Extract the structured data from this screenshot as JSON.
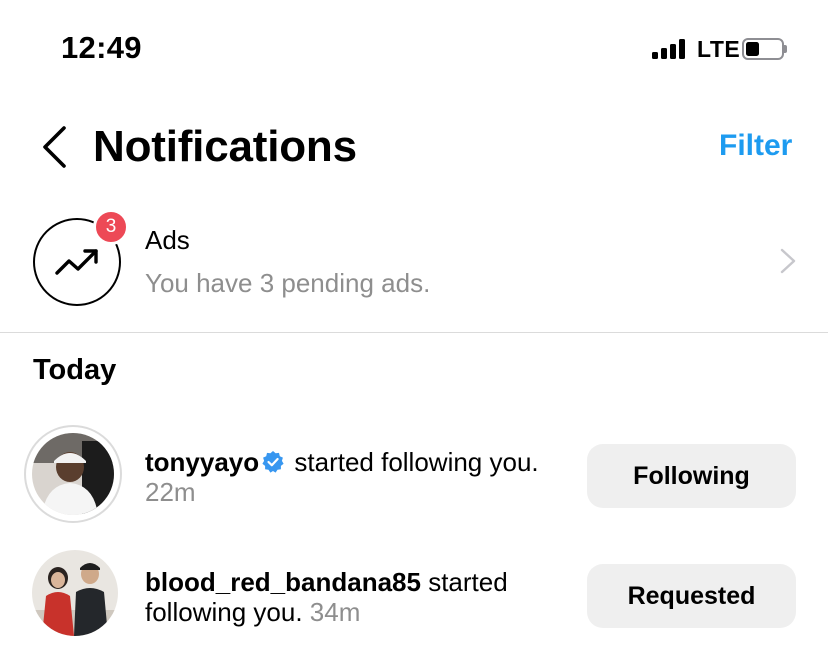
{
  "status_bar": {
    "time": "12:49",
    "network": "LTE",
    "battery_level": 0.35
  },
  "header": {
    "title": "Notifications",
    "filter_label": "Filter"
  },
  "ads": {
    "title": "Ads",
    "subtitle": "You have 3 pending ads.",
    "badge_count": "3"
  },
  "section_title": "Today",
  "notifications": [
    {
      "username": "tonyyayo",
      "verified": true,
      "action": "started following you.",
      "time": "22m",
      "button_label": "Following"
    },
    {
      "username": "blood_red_bandana85",
      "verified": false,
      "action": "started following you.",
      "time": "34m",
      "button_label": "Requested"
    }
  ],
  "colors": {
    "accent": "#1d9bf0",
    "badge": "#ed4956",
    "verified": "#3897f0",
    "muted_text": "#8e8e8e",
    "button_bg": "#efefef"
  }
}
